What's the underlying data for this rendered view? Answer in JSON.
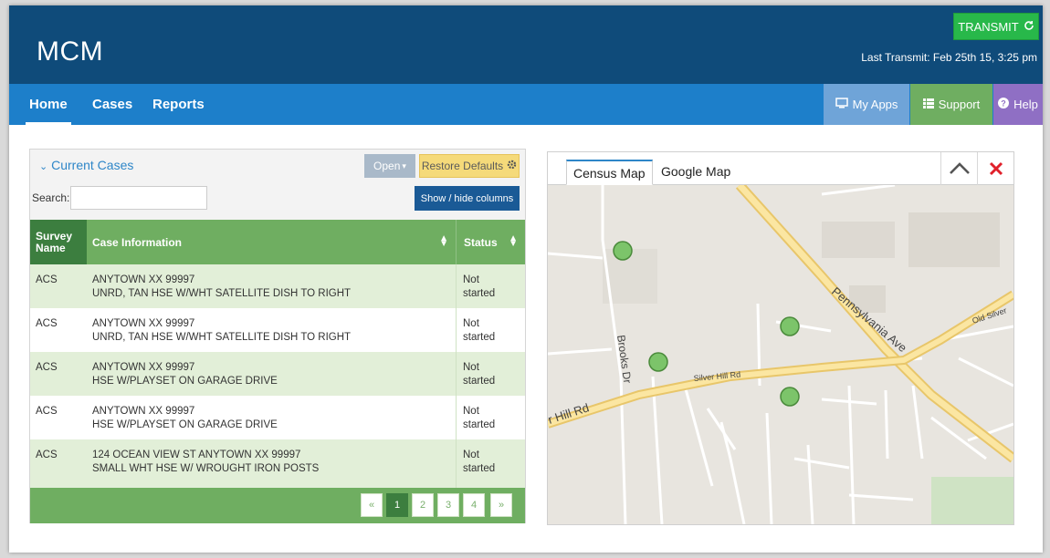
{
  "header": {
    "app_title": "MCM",
    "transmit_label": "TRANSMIT",
    "last_transmit": "Last Transmit: Feb 25th 15, 3:25 pm"
  },
  "nav": {
    "items": [
      "Home",
      "Cases",
      "Reports"
    ],
    "active": "Home",
    "right_buttons": {
      "my_apps": "My Apps",
      "support": "Support",
      "help": "Help"
    }
  },
  "cases_panel": {
    "title": "Current Cases",
    "open_button": "Open",
    "restore_button": "Restore Defaults",
    "search_label": "Search:",
    "search_value": "",
    "show_hide_button": "Show / hide columns",
    "columns": {
      "survey": "Survey Name",
      "case": "Case Information",
      "status": "Status"
    },
    "rows": [
      {
        "survey": "ACS",
        "line1": "ANYTOWN XX 99997",
        "line2": "UNRD, TAN HSE W/WHT SATELLITE DISH TO RIGHT",
        "status1": "Not",
        "status2": "started"
      },
      {
        "survey": "ACS",
        "line1": "ANYTOWN XX 99997",
        "line2": "UNRD, TAN HSE W/WHT SATELLITE DISH TO RIGHT",
        "status1": "Not",
        "status2": "started"
      },
      {
        "survey": "ACS",
        "line1": "ANYTOWN XX 99997",
        "line2": "HSE W/PLAYSET ON GARAGE DRIVE",
        "status1": "Not",
        "status2": "started"
      },
      {
        "survey": "ACS",
        "line1": "ANYTOWN XX 99997",
        "line2": "HSE W/PLAYSET ON GARAGE DRIVE",
        "status1": "Not",
        "status2": "started"
      },
      {
        "survey": "ACS",
        "line1": "124 OCEAN VIEW ST ANYTOWN XX 99997",
        "line2": "SMALL WHT HSE W/ WROUGHT IRON POSTS",
        "status1": "Not",
        "status2": "started"
      }
    ],
    "pagination": {
      "prev": "«",
      "pages": [
        "1",
        "2",
        "3",
        "4"
      ],
      "next": "»",
      "current": "1"
    }
  },
  "map_panel": {
    "tabs": [
      "Census Map",
      "Google Map"
    ],
    "active_tab": "Census Map",
    "labels": {
      "pennsylvania_ave": "Pennsylvania Ave",
      "silver_hill_rd": "Silver Hill Rd",
      "silver_hill_rd_left": "r Hill Rd",
      "brooks_dr": "Brooks Dr",
      "old_silver": "Old Silver"
    }
  },
  "colors": {
    "header_bg": "#0f4b7a",
    "nav_bg": "#1d7fca",
    "transmit_green": "#28b84a",
    "table_green": "#6fae61",
    "table_dark_green": "#3c7e3f",
    "row_alt": "#e2efd8",
    "map_marker": "#7cc46a"
  },
  "icons": {
    "transmit": "refresh-icon",
    "my_apps": "monitor-icon",
    "support": "list-icon",
    "help": "question-circle-icon",
    "panel_toggle": "chevron-down-icon",
    "restore": "gear-icon",
    "collapse": "chevron-up-icon",
    "close": "close-icon"
  }
}
